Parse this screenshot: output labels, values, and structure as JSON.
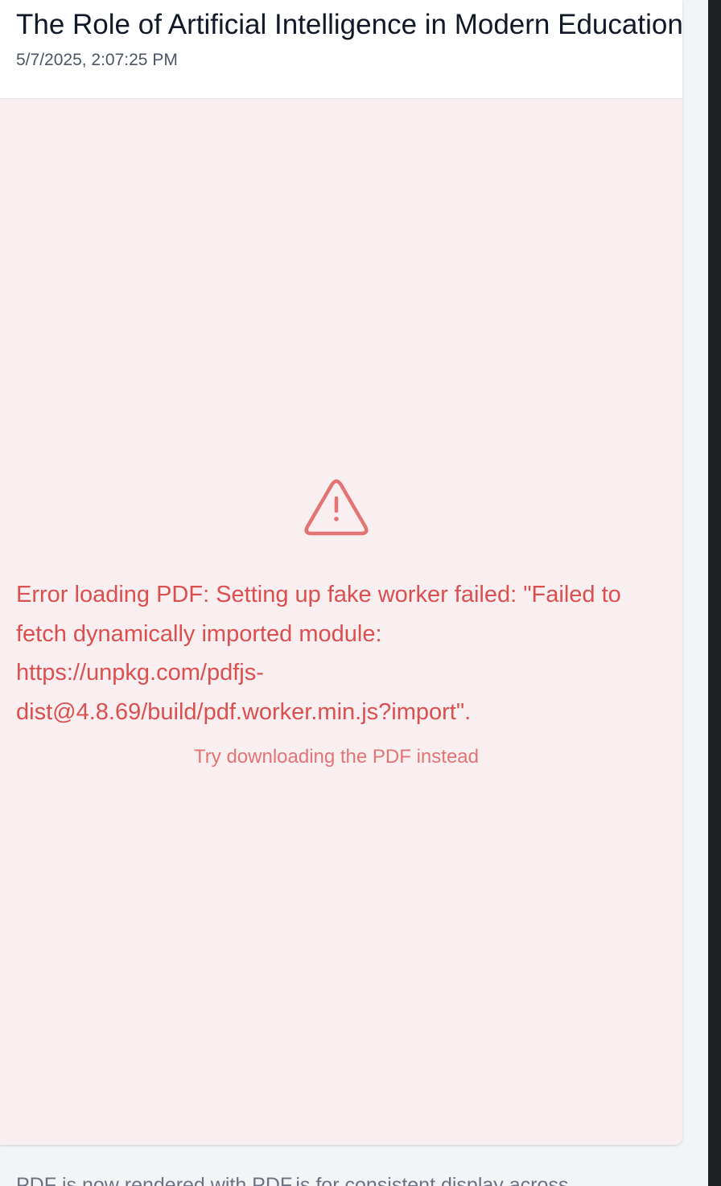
{
  "document": {
    "title": "The Role of Artificial Intelligence in Modern Education",
    "timestamp": "5/7/2025, 2:07:25 PM"
  },
  "viewer": {
    "icon": "warning-triangle-icon",
    "error_message": "Error loading PDF: Setting up fake worker failed: \"Failed to fetch dynamically imported module: https://unpkg.com/pdfjs-dist@4.8.69/build/pdf.worker.min.js?import\".",
    "download_link": "Try downloading the PDF instead"
  },
  "footer": {
    "note": "PDF is now rendered with PDF.js for consistent display across"
  },
  "colors": {
    "error": "#dc4f4f",
    "error_light": "#e47474",
    "viewer_background": "#f9eff0",
    "page_background": "#f3f4f6"
  }
}
